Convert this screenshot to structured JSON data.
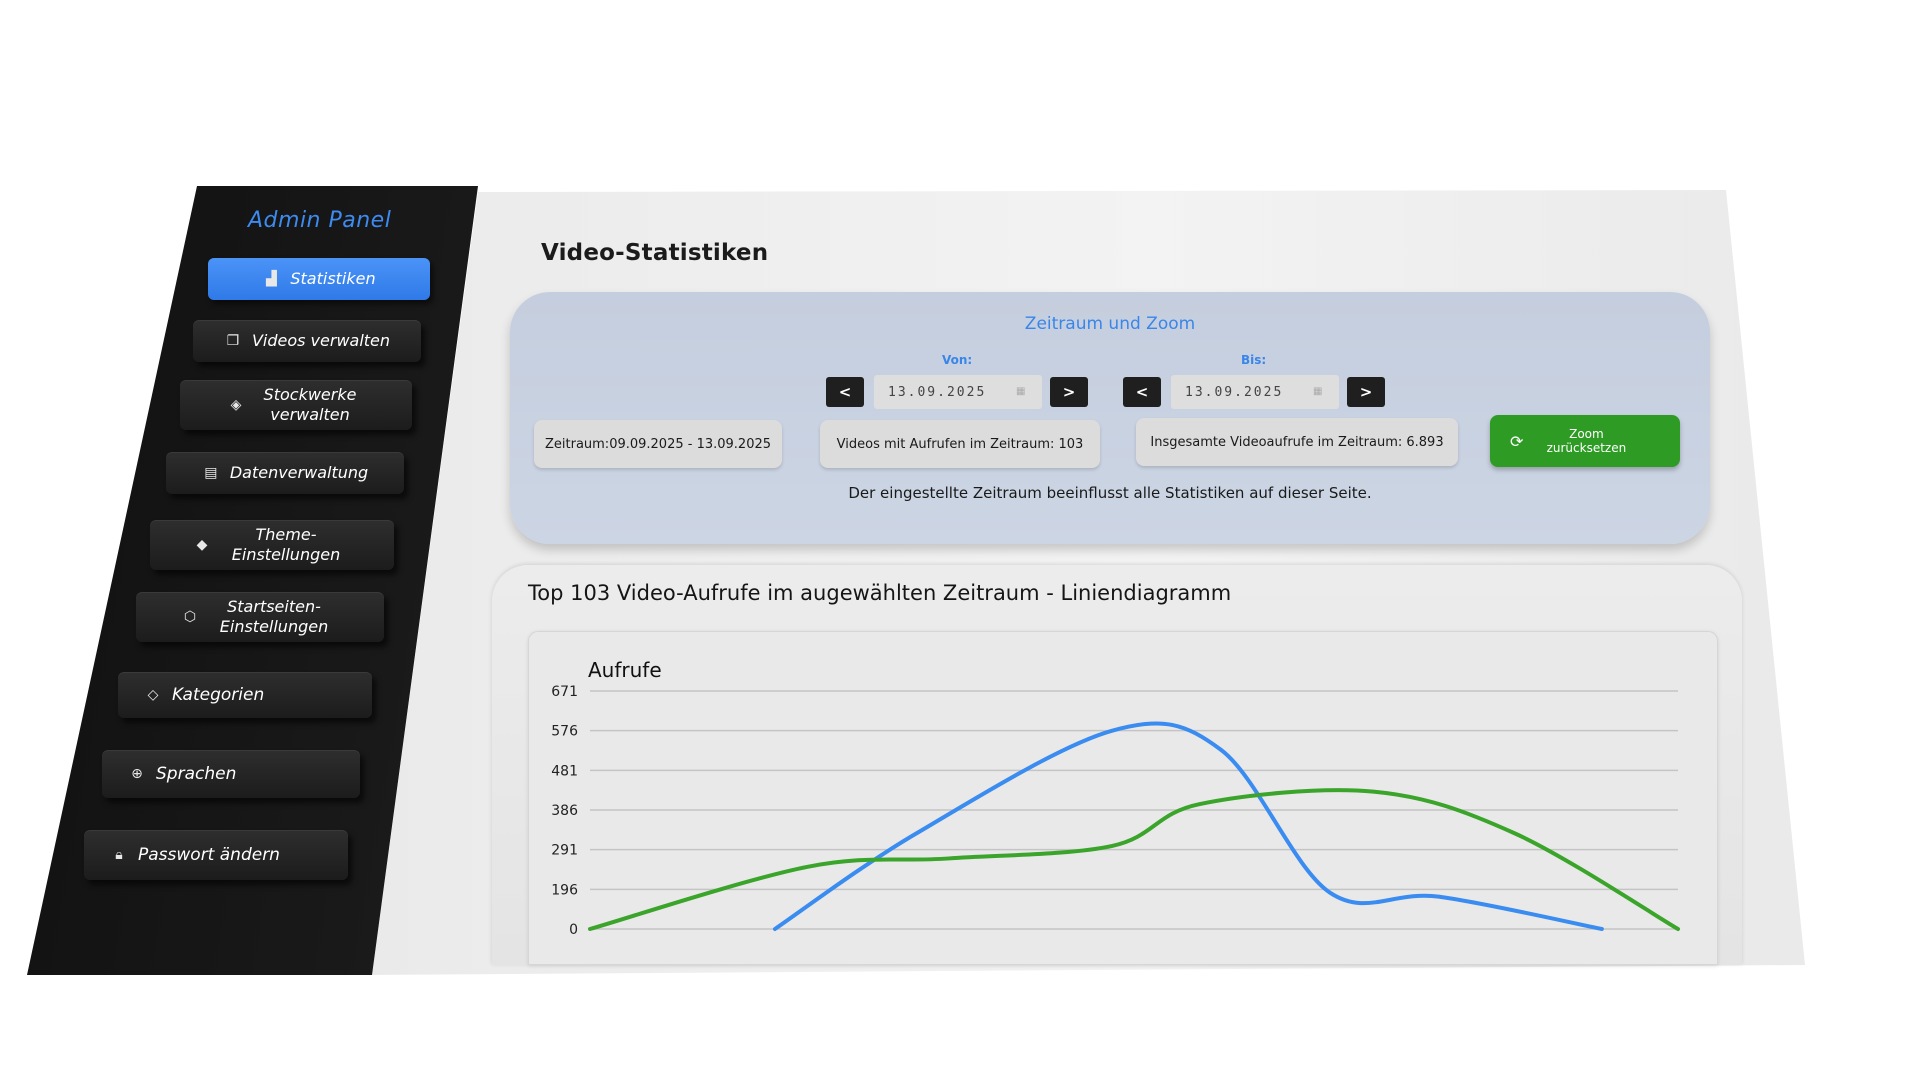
{
  "sidebar": {
    "title": "Admin Panel",
    "items": [
      {
        "label": "Statistiken",
        "icon": "bar-chart-icon",
        "active": true
      },
      {
        "label": "Videos verwalten",
        "icon": "videos-icon"
      },
      {
        "label": "Stockwerke verwalten",
        "icon": "layers-icon"
      },
      {
        "label": "Datenverwaltung",
        "icon": "data-icon"
      },
      {
        "label": "Theme-Einstellungen",
        "icon": "paint-bucket-icon"
      },
      {
        "label": "Startseiten-Einstellungen",
        "icon": "cube-icon"
      },
      {
        "label": "Kategorien",
        "icon": "tag-icon"
      },
      {
        "label": "Sprachen",
        "icon": "globe-icon"
      },
      {
        "label": "Passwort ändern",
        "icon": "lock-icon"
      }
    ]
  },
  "page_title": "Video-Statistiken",
  "range": {
    "title": "Zeitraum und Zoom",
    "from_label": "Von:",
    "to_label": "Bis:",
    "from_value": "13.09.2025",
    "to_value": "13.09.2025",
    "period_text": "Zeitraum:09.09.2025 - 13.09.2025",
    "videos_text": "Videos mit Aufrufen im Zeitraum: 103",
    "total_text": "Insgesamte Videoaufrufe im Zeitraum: 6.893",
    "reset_label": "Zoom zurücksetzen",
    "note": "Der eingestellte Zeitraum beeinflusst alle Statistiken auf dieser Seite."
  },
  "chart_heading": "Top 103 Video-Aufrufe im augewählten Zeitraum - Liniendiagramm",
  "colors": {
    "accent": "#3a86e8",
    "green": "#2e9c24",
    "blue_line": "#3a8cf0",
    "green_line": "#3aa52a"
  },
  "chart_data": {
    "type": "line",
    "ylabel": "Aufrufe",
    "y_ticks": [
      0,
      196,
      291,
      386,
      481,
      576,
      671
    ],
    "ylim": [
      0,
      671
    ],
    "grid": true,
    "series": [
      {
        "color": "#3a8cf0",
        "x": [
          0.17,
          0.3,
          0.48,
          0.58,
          0.68,
          0.78,
          0.93
        ],
        "y": [
          0,
          330,
          576,
          530,
          180,
          160,
          0
        ]
      },
      {
        "color": "#3aa52a",
        "x": [
          0.0,
          0.2,
          0.33,
          0.48,
          0.56,
          0.72,
          0.85,
          1.0
        ],
        "y": [
          0,
          250,
          270,
          300,
          400,
          430,
          330,
          0
        ]
      }
    ]
  }
}
